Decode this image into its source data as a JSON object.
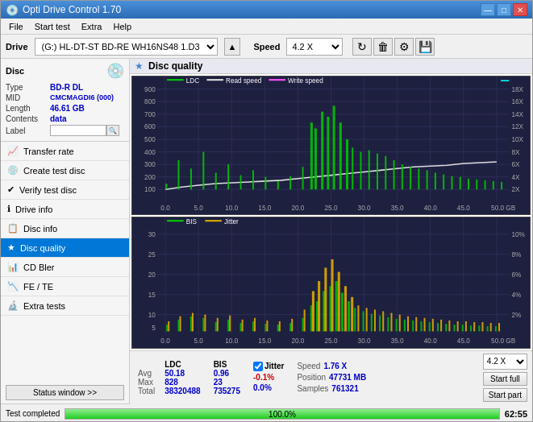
{
  "titleBar": {
    "title": "Opti Drive Control 1.70",
    "icon": "💿",
    "minimize": "—",
    "maximize": "□",
    "close": "✕"
  },
  "menu": {
    "items": [
      "File",
      "Start test",
      "Extra",
      "Help"
    ]
  },
  "driveBar": {
    "label": "Drive",
    "driveValue": "(G:)  HL-DT-ST BD-RE  WH16NS48 1.D3",
    "speedLabel": "Speed",
    "speedValue": "4.2 X"
  },
  "disc": {
    "title": "Disc",
    "typeLabel": "Type",
    "typeValue": "BD-R DL",
    "midLabel": "MID",
    "midValue": "CMCMAGDI6 (000)",
    "lengthLabel": "Length",
    "lengthValue": "46.61 GB",
    "contentsLabel": "Contents",
    "contentsValue": "data",
    "labelLabel": "Label"
  },
  "navItems": [
    {
      "id": "transfer-rate",
      "label": "Transfer rate",
      "icon": "📈"
    },
    {
      "id": "create-test-disc",
      "label": "Create test disc",
      "icon": "💿"
    },
    {
      "id": "verify-test-disc",
      "label": "Verify test disc",
      "icon": "✔"
    },
    {
      "id": "drive-info",
      "label": "Drive info",
      "icon": "ℹ"
    },
    {
      "id": "disc-info",
      "label": "Disc info",
      "icon": "📋"
    },
    {
      "id": "disc-quality",
      "label": "Disc quality",
      "icon": "★",
      "active": true
    },
    {
      "id": "cd-bler",
      "label": "CD Bler",
      "icon": "📊"
    },
    {
      "id": "fe-te",
      "label": "FE / TE",
      "icon": "📉"
    },
    {
      "id": "extra-tests",
      "label": "Extra tests",
      "icon": "🔬"
    }
  ],
  "statusWindowBtn": "Status window >>",
  "chartPanel": {
    "title": "Disc quality",
    "legend1": {
      "ldc": "LDC",
      "readSpeed": "Read speed",
      "writeSpeed": "Write speed"
    },
    "legend2": {
      "bis": "BIS",
      "jitter": "Jitter"
    },
    "yAxisMax1": 900,
    "yAxisLabels1": [
      "900",
      "800",
      "700",
      "600",
      "500",
      "400",
      "300",
      "200",
      "100"
    ],
    "yAxisRight1": [
      "18X",
      "16X",
      "14X",
      "12X",
      "10X",
      "8X",
      "6X",
      "4X",
      "2X"
    ],
    "xAxisLabels": [
      "0.0",
      "5.0",
      "10.0",
      "15.0",
      "20.0",
      "25.0",
      "30.0",
      "35.0",
      "40.0",
      "45.0",
      "50.0 GB"
    ],
    "yAxisMax2": 30,
    "yAxisLabels2": [
      "30",
      "25",
      "20",
      "15",
      "10",
      "5"
    ],
    "yAxisRight2": [
      "10%",
      "8%",
      "6%",
      "4%",
      "2%"
    ]
  },
  "stats": {
    "ldcLabel": "LDC",
    "bisLabel": "BIS",
    "jitterLabel": "Jitter",
    "avgLabel": "Avg",
    "maxLabel": "Max",
    "totalLabel": "Total",
    "avgLdc": "50.18",
    "avgBis": "0.96",
    "avgJitter": "-0.1%",
    "maxLdc": "828",
    "maxBis": "23",
    "maxJitter": "0.0%",
    "totalLdc": "38320488",
    "totalBis": "735275",
    "speedLabel": "Speed",
    "speedValue": "1.76 X",
    "positionLabel": "Position",
    "positionValue": "47731 MB",
    "samplesLabel": "Samples",
    "samplesValue": "761321",
    "speedSelectValue": "4.2 X"
  },
  "bottomBar": {
    "statusText": "Test completed",
    "progressPct": 100,
    "progressLabel": "100.0%",
    "timeLabel": "62:55"
  },
  "buttons": {
    "startFull": "Start full",
    "startPart": "Start part"
  }
}
